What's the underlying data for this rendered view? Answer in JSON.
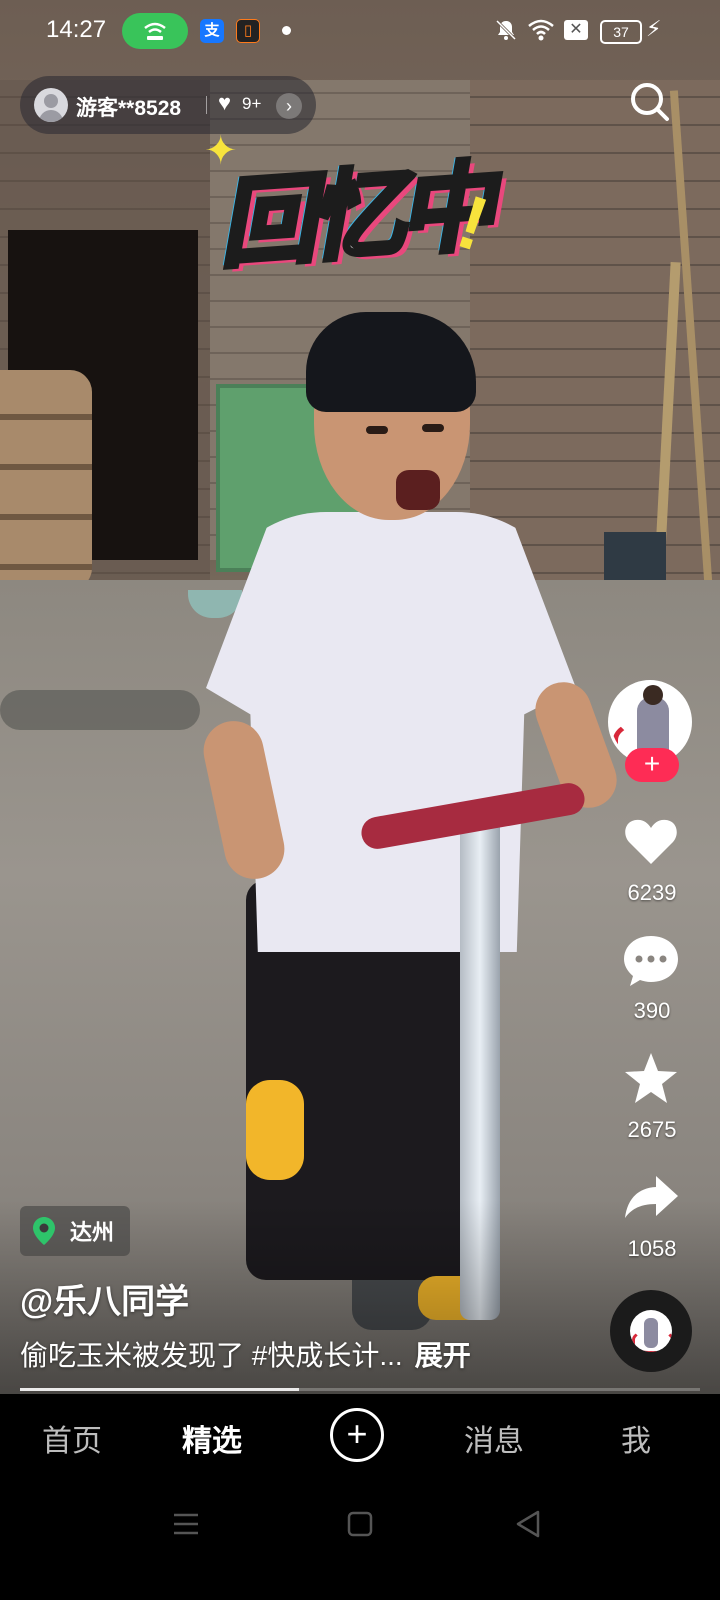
{
  "status_bar": {
    "time": "14:27",
    "battery": "37",
    "mini_app_a": "支"
  },
  "top": {
    "guest_name": "游客**8528",
    "likes_badge": "9+"
  },
  "video": {
    "sticker_text": "回忆中",
    "sticker_mark": "!"
  },
  "rail": {
    "follow_symbol": "+",
    "likes": "6239",
    "comments": "390",
    "favorites": "2675",
    "shares": "1058"
  },
  "caption": {
    "location": "达州",
    "author": "@乐八同学",
    "description": "偷吃玉米被发现了 #快成长计...",
    "expand": "展开",
    "progress": 0.41
  },
  "nav": {
    "home": "首页",
    "featured": "精选",
    "plus": "+",
    "messages": "消息",
    "me": "我",
    "active": "featured"
  },
  "colors": {
    "follow": "#fe2c55",
    "pill": "#39c45a",
    "location_pin": "#2ec46a"
  },
  "icons": [
    "search-icon",
    "heart-icon",
    "comment-icon",
    "star-icon",
    "share-icon",
    "location-pin-icon",
    "menu-icon",
    "home-square-icon",
    "back-triangle-icon"
  ]
}
